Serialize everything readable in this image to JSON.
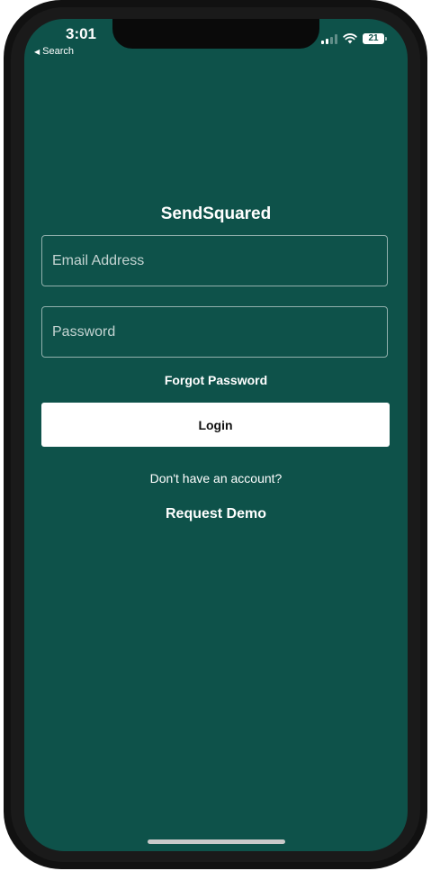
{
  "status_bar": {
    "time": "3:01",
    "back_label": "Search",
    "back_icon": "back-triangle-icon",
    "battery_level": "21",
    "icons": [
      "cellular-signal-icon",
      "wifi-icon",
      "battery-icon"
    ]
  },
  "app": {
    "title": "SendSquared"
  },
  "form": {
    "email_placeholder": "Email Address",
    "email_value": "",
    "password_placeholder": "Password",
    "password_value": "",
    "forgot_password_label": "Forgot Password",
    "login_label": "Login"
  },
  "footer": {
    "no_account_text": "Don't have an account?",
    "request_demo_label": "Request Demo"
  },
  "colors": {
    "background": "#0e524a",
    "button_bg": "#ffffff",
    "text": "#ffffff"
  }
}
